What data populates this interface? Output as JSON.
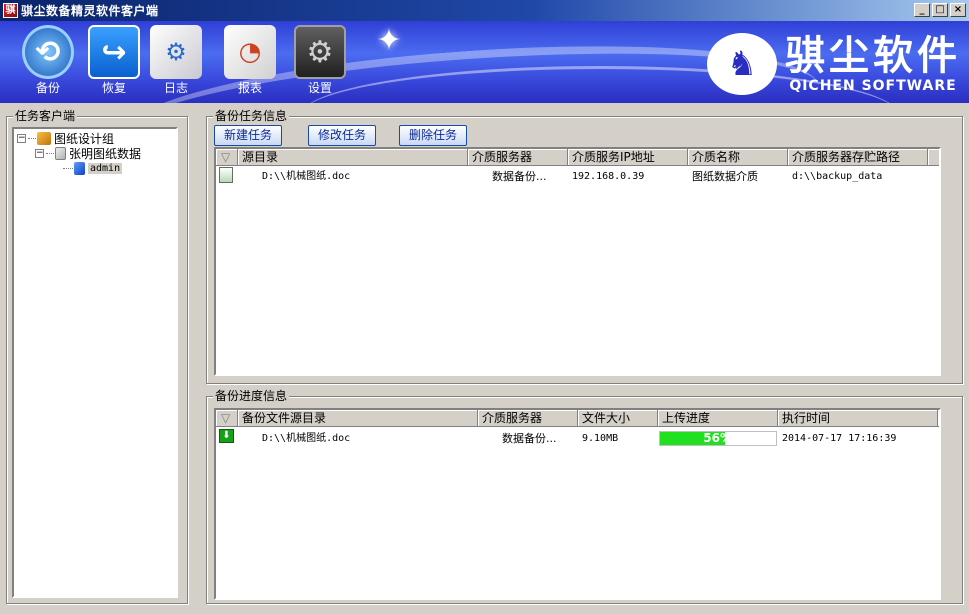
{
  "window": {
    "title": "骐尘数备精灵软件客户端",
    "minimize_glyph": "_",
    "maximize_glyph": "□",
    "close_glyph": "×"
  },
  "toolbar": {
    "items": [
      {
        "label": "备份",
        "icon": "backup-icon"
      },
      {
        "label": "恢复",
        "icon": "restore-icon"
      },
      {
        "label": "日志",
        "icon": "log-icon"
      },
      {
        "label": "报表",
        "icon": "report-icon"
      },
      {
        "label": "设置",
        "icon": "settings-icon"
      }
    ]
  },
  "brand": {
    "name_cn": "骐尘软件",
    "name_en": "QICHEN SOFTWARE"
  },
  "client_panel": {
    "title": "任务客户端",
    "tree": [
      {
        "label": "图纸设计组",
        "level": 0,
        "expand": "−"
      },
      {
        "label": "张明图纸数据",
        "level": 1,
        "expand": "−"
      },
      {
        "label": "admin",
        "level": 2,
        "selected": true
      }
    ]
  },
  "task_panel": {
    "title": "备份任务信息",
    "buttons": {
      "new": "新建任务",
      "edit": "修改任务",
      "delete": "删除任务"
    },
    "columns": [
      "源目录",
      "介质服务器",
      "介质服务IP地址",
      "介质名称",
      "介质服务器存贮路径"
    ],
    "rows": [
      {
        "source": "D:\\\\机械图纸.doc",
        "server": "数据备份...",
        "ip": "192.168.0.39",
        "media": "图纸数据介质",
        "path": "d:\\\\backup_data"
      }
    ]
  },
  "progress_panel": {
    "title": "备份进度信息",
    "columns": [
      "备份文件源目录",
      "介质服务器",
      "文件大小",
      "上传进度",
      "执行时间"
    ],
    "rows": [
      {
        "source": "D:\\\\机械图纸.doc",
        "server": "数据备份...",
        "size": "9.10MB",
        "progress": 56,
        "progress_label": "56%",
        "time": "2014-07-17 17:16:39"
      }
    ]
  },
  "colors": {
    "banner": "#3a4bde",
    "progress": "#20e020",
    "titlebar": "#0a246a"
  }
}
